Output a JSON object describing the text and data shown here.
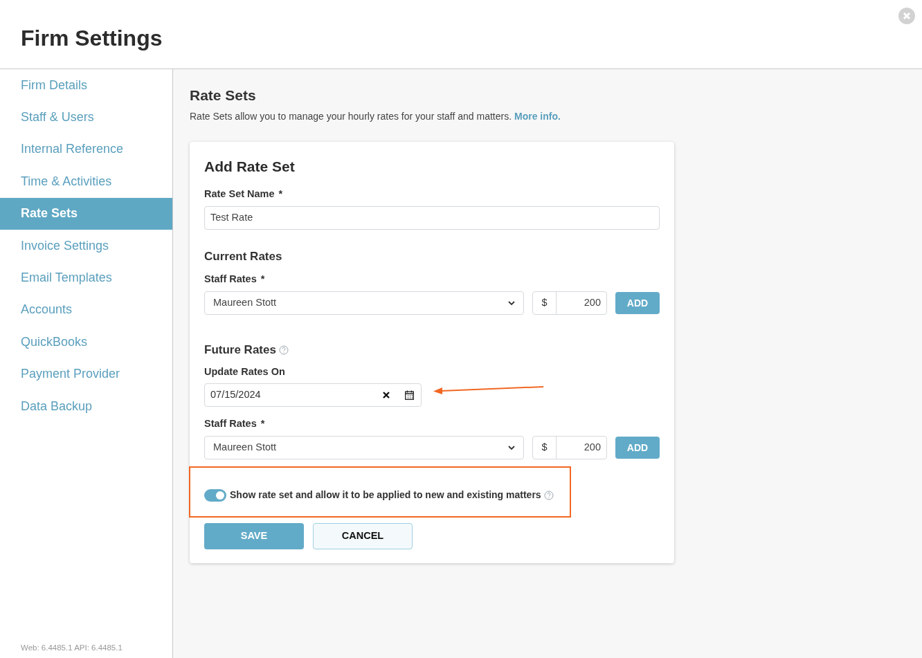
{
  "window": {
    "title": "Firm Settings"
  },
  "sidebar": {
    "items": [
      {
        "label": "Firm Details",
        "selected": false
      },
      {
        "label": "Staff & Users",
        "selected": false
      },
      {
        "label": "Internal Reference",
        "selected": false
      },
      {
        "label": "Time & Activities",
        "selected": false
      },
      {
        "label": "Rate Sets",
        "selected": true
      },
      {
        "label": "Invoice Settings",
        "selected": false
      },
      {
        "label": "Email Templates",
        "selected": false
      },
      {
        "label": "Accounts",
        "selected": false
      },
      {
        "label": "QuickBooks",
        "selected": false
      },
      {
        "label": "Payment Provider",
        "selected": false
      },
      {
        "label": "Data Backup",
        "selected": false
      }
    ],
    "version": "Web: 6.4485.1 API: 6.4485.1"
  },
  "page": {
    "title": "Rate Sets",
    "description": "Rate Sets allow you to manage your hourly rates for your staff and matters.",
    "link": "More info."
  },
  "form": {
    "title": "Add Rate Set",
    "name_label": "Rate Set Name",
    "name_required": "*",
    "name_value": "Test Rate",
    "current": {
      "heading": "Current Rates",
      "staff_label": "Staff Rates",
      "required": "*",
      "staff_value": "Maureen Stott",
      "currency": "$",
      "rate": "200",
      "add": "ADD"
    },
    "future": {
      "heading": "Future Rates",
      "date_label": "Update Rates On",
      "date_value": "07/15/2024",
      "staff_label": "Staff Rates",
      "required": "*",
      "staff_value": "Maureen Stott",
      "currency": "$",
      "rate": "200",
      "add": "ADD"
    },
    "toggle": {
      "label": "Show rate set and allow it to be applied to new and existing matters",
      "on": true
    },
    "save": "SAVE",
    "cancel": "CANCEL"
  }
}
